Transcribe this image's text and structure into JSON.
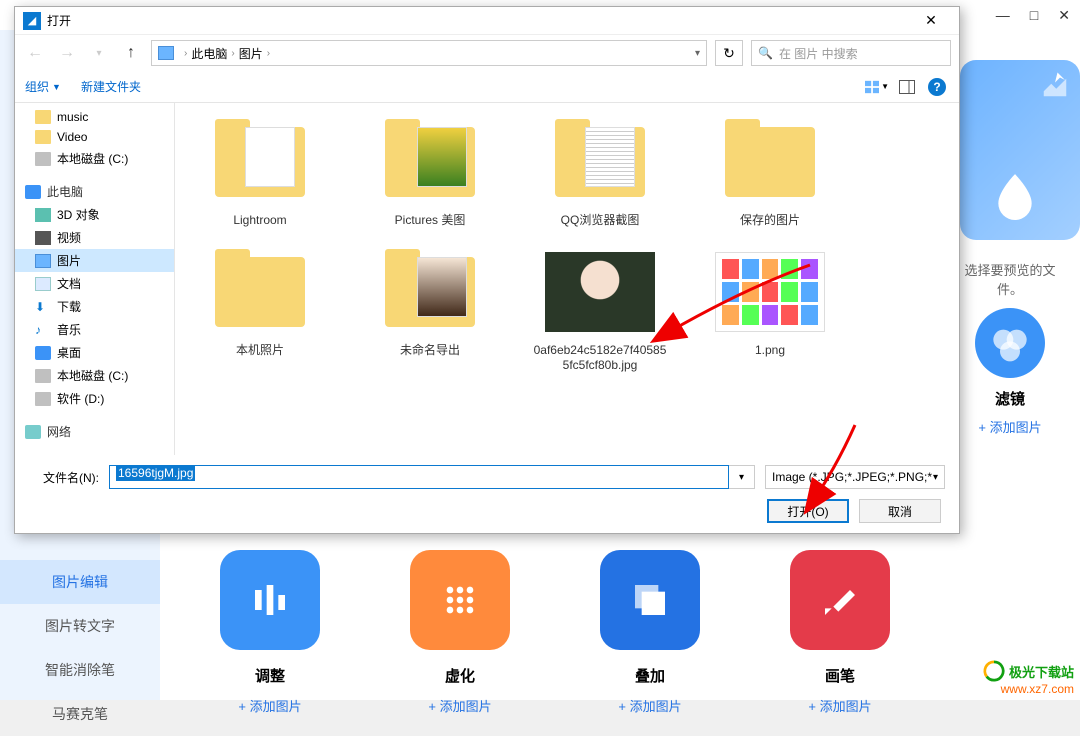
{
  "bg": {
    "titlebar": {
      "min": "—",
      "max": "□",
      "close": "✕"
    },
    "sidebar": {
      "items": [
        {
          "label": "图片编辑",
          "active": true
        },
        {
          "label": "图片转文字"
        },
        {
          "label": "智能消除笔"
        },
        {
          "label": "马赛克笔"
        }
      ]
    },
    "cards": [
      {
        "title": "调整",
        "add": "添加图片",
        "color": "#3b93f7"
      },
      {
        "title": "虚化",
        "add": "添加图片",
        "color": "#ff8a3c"
      },
      {
        "title": "叠加",
        "add": "添加图片",
        "color": "#2472e3"
      },
      {
        "title": "画笔",
        "add": "添加图片",
        "color": "#e43b4a"
      }
    ],
    "right": {
      "hint": "选择要预览的文件。",
      "filter_label": "滤镜",
      "add": "添加图片"
    }
  },
  "dialog": {
    "title": "打开",
    "breadcrumb": {
      "root": "此电脑",
      "folder": "图片"
    },
    "search_placeholder": "在 图片 中搜索",
    "toolbar": {
      "organize": "组织",
      "newfolder": "新建文件夹"
    },
    "tree": {
      "quick": [
        {
          "label": "music",
          "icon": "ico-folder"
        },
        {
          "label": "Video",
          "icon": "ico-folder"
        },
        {
          "label": "本地磁盘 (C:)",
          "icon": "ico-disk"
        }
      ],
      "thispc_label": "此电脑",
      "thispc": [
        {
          "label": "3D 对象",
          "icon": "ico-folder"
        },
        {
          "label": "视频",
          "icon": "ico-folder"
        },
        {
          "label": "图片",
          "icon": "ico-pictures",
          "selected": true
        },
        {
          "label": "文档",
          "icon": "ico-doc"
        },
        {
          "label": "下载",
          "icon": "ico-down"
        },
        {
          "label": "音乐",
          "icon": "ico-note"
        },
        {
          "label": "桌面",
          "icon": "ico-monitor"
        },
        {
          "label": "本地磁盘 (C:)",
          "icon": "ico-disk"
        },
        {
          "label": "软件 (D:)",
          "icon": "ico-disk"
        }
      ],
      "network_label": "网络"
    },
    "files": [
      {
        "name": "Lightroom",
        "type": "folder"
      },
      {
        "name": "Pictures 美图",
        "type": "folder-photo"
      },
      {
        "name": "QQ浏览器截图",
        "type": "folder-doc"
      },
      {
        "name": "保存的图片",
        "type": "folder"
      },
      {
        "name": "本机照片",
        "type": "folder"
      },
      {
        "name": "未命名导出",
        "type": "folder-person"
      },
      {
        "name": "0af6eb24c5182e7f40585\n5fc5fcf80b.jpg",
        "type": "img-face"
      },
      {
        "name": "1.png",
        "type": "img-screenshot"
      }
    ],
    "footer": {
      "filename_label": "文件名(N):",
      "filename_value": "16596tjgM.jpg",
      "filter_text": "Image (*.JPG;*.JPEG;*.PNG;*.I",
      "open_btn": "打开(O)",
      "cancel_btn": "取消"
    }
  },
  "watermark": {
    "line1": "极光下载站",
    "line2": "www.xz7.com"
  }
}
